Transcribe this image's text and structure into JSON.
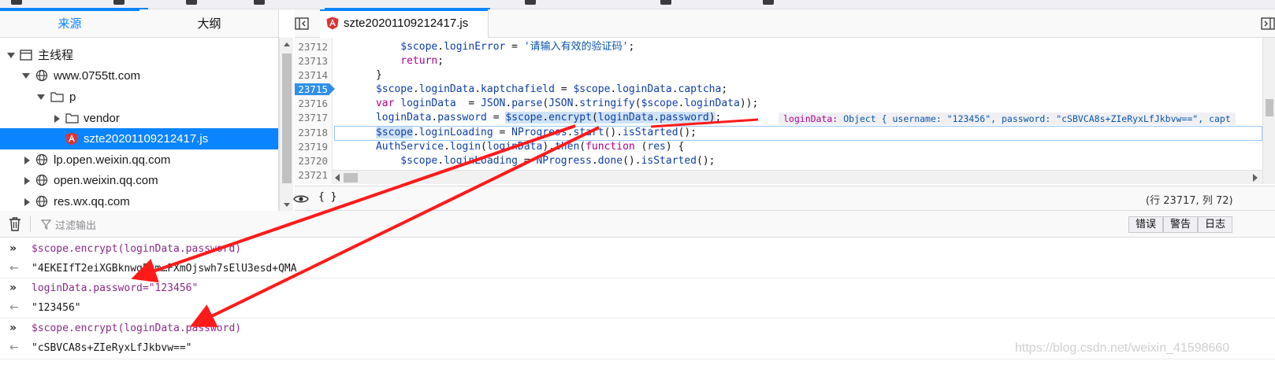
{
  "sidebar": {
    "tabs": [
      {
        "label": "来源",
        "active": true
      },
      {
        "label": "大纲",
        "active": false
      }
    ],
    "tree": [
      {
        "label": "主线程",
        "icon": "window-icon",
        "expanded": true
      },
      {
        "label": "www.0755tt.com",
        "icon": "globe-icon",
        "expanded": true
      },
      {
        "label": "p",
        "icon": "folder-icon",
        "expanded": true
      },
      {
        "label": "vendor",
        "icon": "folder-icon",
        "expanded": false
      },
      {
        "label": "szte20201109212417.js",
        "icon": "angular-file-icon",
        "selected": true
      },
      {
        "label": "lp.open.weixin.qq.com",
        "icon": "globe-icon",
        "expanded": false
      },
      {
        "label": "open.weixin.qq.com",
        "icon": "globe-icon",
        "expanded": false
      },
      {
        "label": "res.wx.qq.com",
        "icon": "globe-icon",
        "expanded": false
      }
    ]
  },
  "editor": {
    "tab_label": "szte20201109212417.js",
    "line_numbers": [
      "23712",
      "23713",
      "23714",
      "23715",
      "23716",
      "23717",
      "23718",
      "23719",
      "23720",
      "23721"
    ],
    "breakpoint_line": "23715",
    "code": {
      "l23712": {
        "obj": "$scope",
        "prop": "loginError",
        "str": "'请输入有效的验证码'"
      },
      "l23713": {
        "kw": "return"
      },
      "l23714": {
        "text": "}"
      },
      "l23715": {
        "a": "$scope",
        "b": "loginData",
        "c": "kaptchafield",
        "d": "$scope",
        "e": "loginData",
        "f": "captcha"
      },
      "l23716": {
        "kw": "var",
        "name": "loginData",
        "json1": "JSON",
        "parse": "parse",
        "json2": "JSON",
        "stringify": "stringify",
        "arg": "$scope",
        "arg2": "loginData"
      },
      "l23717": {
        "a": "loginData",
        "b": "password",
        "c": "$scope",
        "d": "encrypt",
        "e": "loginData",
        "f": "password"
      },
      "l23718": {
        "a": "$scope",
        "b": "loginLoading",
        "c": "NProgress",
        "d": "start",
        "e": "isStarted"
      },
      "l23719": {
        "a": "AuthService",
        "b": "login",
        "c": "loginData",
        "d": "then",
        "kw": "function",
        "e": "res"
      },
      "l23720": {
        "a": "$scope",
        "b": "loginLoading",
        "c": "NProgress",
        "d": "done",
        "e": "isStarted"
      }
    },
    "inline_preview": {
      "label": "loginData:",
      "value": "Object { username: \"123456\", password: \"cSBVCA8s+ZIeRyxLfJkbvw==\", capt"
    },
    "footer_braces": "{ }",
    "cursor_position": "(行 23717, 列 72)"
  },
  "console": {
    "filter_placeholder": "过滤输出",
    "filter_buttons": [
      "错误",
      "警告",
      "日志"
    ],
    "entries": [
      {
        "type": "input",
        "text": "$scope.encrypt(loginData.password)"
      },
      {
        "type": "output",
        "text": "\"4EKEIfT2eiXGBknwg5sm…FXmOjswh7sElU3esd+QMA"
      },
      {
        "type": "input",
        "text": "loginData.password=\"123456\""
      },
      {
        "type": "output",
        "text": "\"123456\""
      },
      {
        "type": "input",
        "text": "$scope.encrypt(loginData.password)"
      },
      {
        "type": "output",
        "text": "\"cSBVCA8s+ZIeRyxLfJkbvw==\""
      }
    ]
  },
  "watermark": "https://blog.csdn.net/weixin_41598660",
  "colors": {
    "accent": "#0a84ff",
    "annotation": "#ff1a1a"
  }
}
